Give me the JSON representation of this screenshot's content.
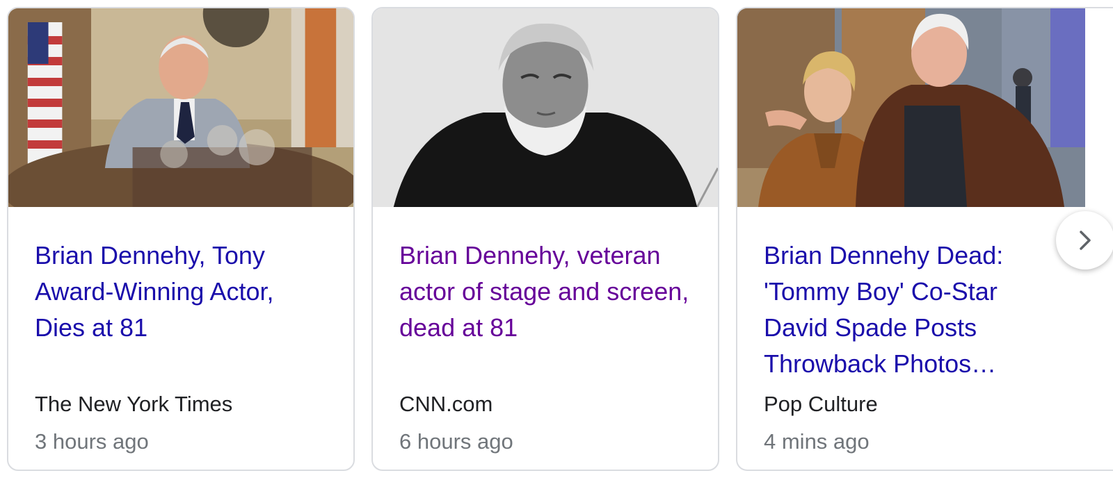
{
  "cards": [
    {
      "headline": "Brian Dennehy, Tony Award-Winning Actor, Dies at 81",
      "source": "The New York Times",
      "time": "3 hours ago",
      "visited": false
    },
    {
      "headline": "Brian Dennehy, veteran actor of stage and screen, dead at 81",
      "source": "CNN.com",
      "time": "6 hours ago",
      "visited": true
    },
    {
      "headline": "Brian Dennehy Dead: 'Tommy Boy' Co-Star David Spade Posts Throwback Photos…",
      "source": "Pop Culture",
      "time": "4 mins ago",
      "visited": false
    }
  ],
  "next_button": {
    "icon": "chevron-right-icon"
  },
  "colors": {
    "link": "#1a0dab",
    "visited_link": "#660099",
    "source": "#202124",
    "time": "#70757a",
    "border": "#dadce0"
  }
}
